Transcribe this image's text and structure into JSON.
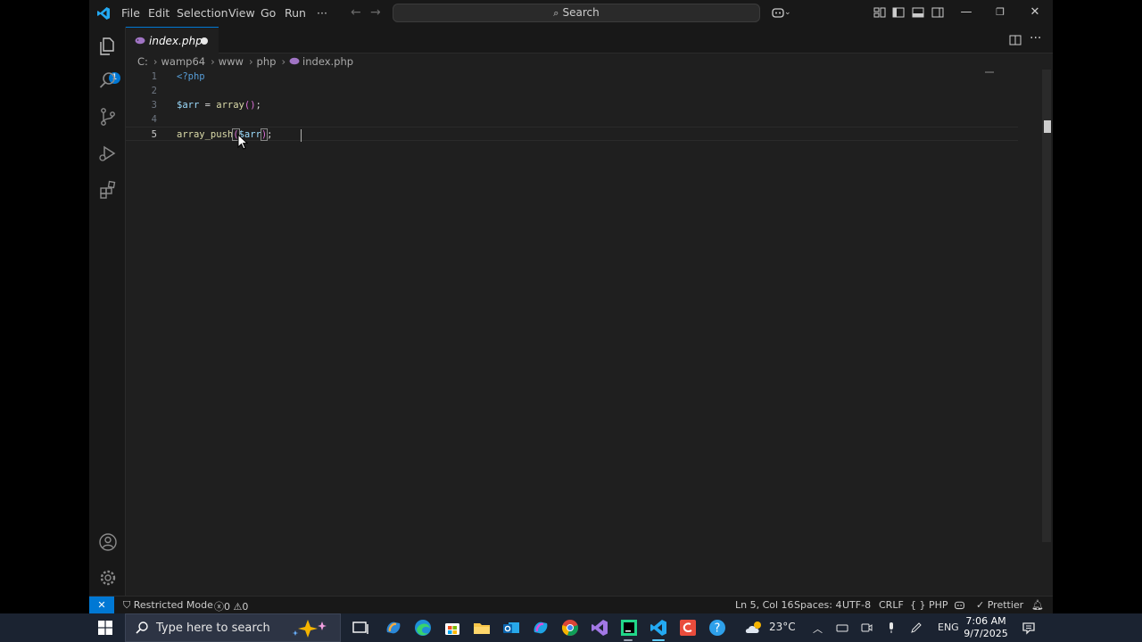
{
  "titlebar": {
    "menus": [
      "File",
      "Edit",
      "Selection",
      "View",
      "Go",
      "Run",
      "···"
    ],
    "search_label": "Search"
  },
  "activity": {
    "explorer_badge": "1"
  },
  "tab": {
    "label": "index.php"
  },
  "breadcrumb": [
    "C:",
    "wamp64",
    "www",
    "php",
    "index.php"
  ],
  "editor": {
    "line_numbers": [
      "1",
      "2",
      "3",
      "4",
      "5"
    ],
    "line1": "<?php",
    "line3": {
      "var": "$arr",
      "op": " = ",
      "fn": "array",
      "brack": "()",
      "semi": ";"
    },
    "line5": {
      "fn": "array_push",
      "open": "(",
      "var": "$arr",
      "close": ")",
      "semi": ";"
    },
    "active_line": 5
  },
  "statusbar": {
    "remote": "✕",
    "restricted": "Restricted Mode",
    "errors": "0",
    "warnings": "0",
    "position": "Ln 5, Col 16",
    "spaces": "Spaces: 4",
    "encoding": "UTF-8",
    "eol": "CRLF",
    "language": "PHP",
    "prettier": "Prettier"
  },
  "taskbar": {
    "search_placeholder": "Type here to search",
    "weather": "23°C",
    "lang": "ENG",
    "time": "7:06 AM",
    "date": "9/7/2025"
  },
  "colors": {
    "accent": "#0078d4",
    "editor_bg": "#1f1f1f",
    "chrome_bg": "#181818"
  }
}
